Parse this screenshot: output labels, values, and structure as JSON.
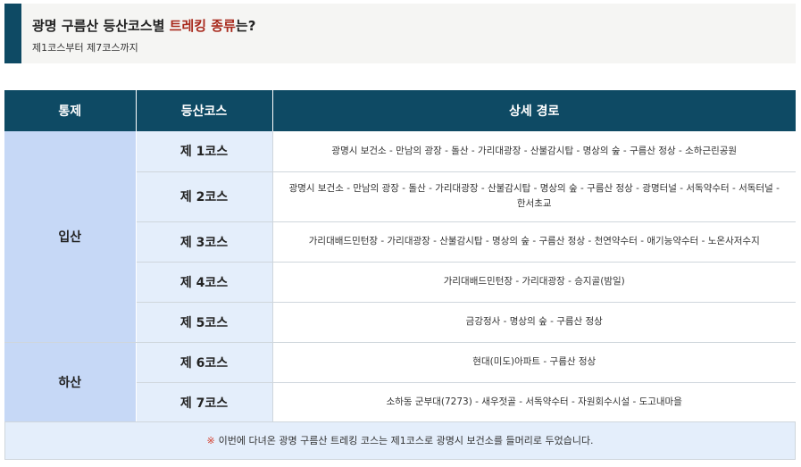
{
  "header": {
    "title_prefix": "광명 구름산 등산코스별 ",
    "title_highlight": "트레킹 종류",
    "title_suffix": "는?",
    "subtitle": "제1코스부터 제7코스까지"
  },
  "table": {
    "columns": [
      "통제",
      "등산코스",
      "상세 경로"
    ],
    "groups": [
      {
        "label": "입산",
        "rows": [
          {
            "course": "제 1코스",
            "route": "광명시 보건소 - 만남의 광장 - 돌산 - 가리대광장 - 산불감시탑 - 명상의 숲 - 구름산 정상 - 소하근린공원"
          },
          {
            "course": "제 2코스",
            "route": "광명시 보건소 - 만남의 광장 - 돌산 - 가리대광장 - 산불감시탑 - 명상의 숲 - 구름산 정상 - 광명터널 - 서독약수터 - 서독터널 - 한서초교"
          },
          {
            "course": "제 3코스",
            "route": "가리대배드민턴장 - 가리대광장 - 산불감시탑 - 명상의 숲 - 구름산 정상 - 천연약수터 - 애기능약수터 - 노온사저수지"
          },
          {
            "course": "제 4코스",
            "route": "가리대배드민턴장 - 가리대광장 - 승지골(밤일)"
          },
          {
            "course": "제 5코스",
            "route": "금강정사 - 명상의 숲 - 구름산 정상"
          }
        ]
      },
      {
        "label": "하산",
        "rows": [
          {
            "course": "제 6코스",
            "route": "현대(미도)아파트 - 구름산 정상"
          },
          {
            "course": "제 7코스",
            "route": "소하동 군부대(7273) - 새우젓골 - 서독약수터 - 자원회수시설 - 도고내마을"
          }
        ]
      }
    ]
  },
  "note": {
    "mark": "※",
    "text": "이번에 다녀온 광명 구름산 트레킹 코스는 제1코스로 광명시 보건소를 들머리로 두었습니다."
  },
  "colors": {
    "header_dark": "#0e4a64",
    "highlight_red": "#a8291c",
    "group_cell": "#c6d8f6",
    "course_cell": "#e4eefb"
  }
}
